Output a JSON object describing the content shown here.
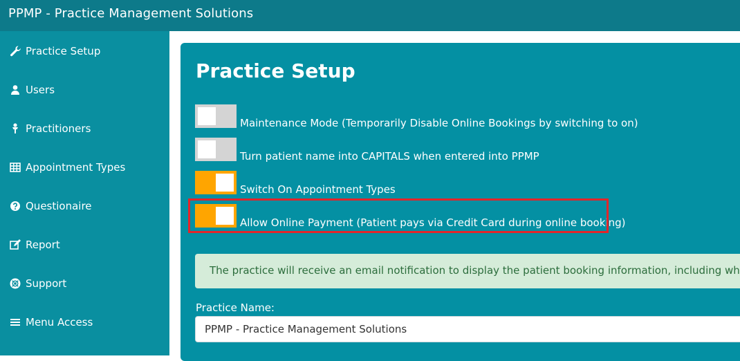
{
  "app": {
    "title": "PPMP - Practice Management Solutions"
  },
  "colors": {
    "topbar": "#0d7a8a",
    "sidebar": "#0a8fa0",
    "panel": "#0490a3",
    "toggle_on": "#ffa500",
    "toggle_off": "#d4d4d4",
    "highlight": "#e3252a",
    "alert_bg": "#d5ecd9"
  },
  "sidebar": {
    "items": [
      {
        "label": "Practice Setup",
        "icon": "wrench-icon"
      },
      {
        "label": "Users",
        "icon": "user-icon"
      },
      {
        "label": "Practitioners",
        "icon": "user-md-icon"
      },
      {
        "label": "Appointment Types",
        "icon": "table-icon"
      },
      {
        "label": "Questionaire",
        "icon": "question-circle-icon"
      },
      {
        "label": "Report",
        "icon": "edit-icon"
      },
      {
        "label": "Support",
        "icon": "life-ring-icon"
      },
      {
        "label": "Menu Access",
        "icon": "bars-icon"
      }
    ]
  },
  "main": {
    "title": "Practice Setup",
    "toggles": [
      {
        "label": "Maintenance Mode (Temporarily Disable Online Bookings by switching to on)",
        "state": "off"
      },
      {
        "label": "Turn patient name into CAPITALS when entered into PPMP",
        "state": "off"
      },
      {
        "label": "Switch On Appointment Types",
        "state": "on"
      },
      {
        "label": "Allow Online Payment (Patient pays via Credit Card during online booking)",
        "state": "on"
      }
    ],
    "alert": "The practice will receive an email notification to display the patient booking information, including which prac",
    "practice_name": {
      "label": "Practice Name:",
      "value": "PPMP - Practice Management Solutions"
    }
  }
}
